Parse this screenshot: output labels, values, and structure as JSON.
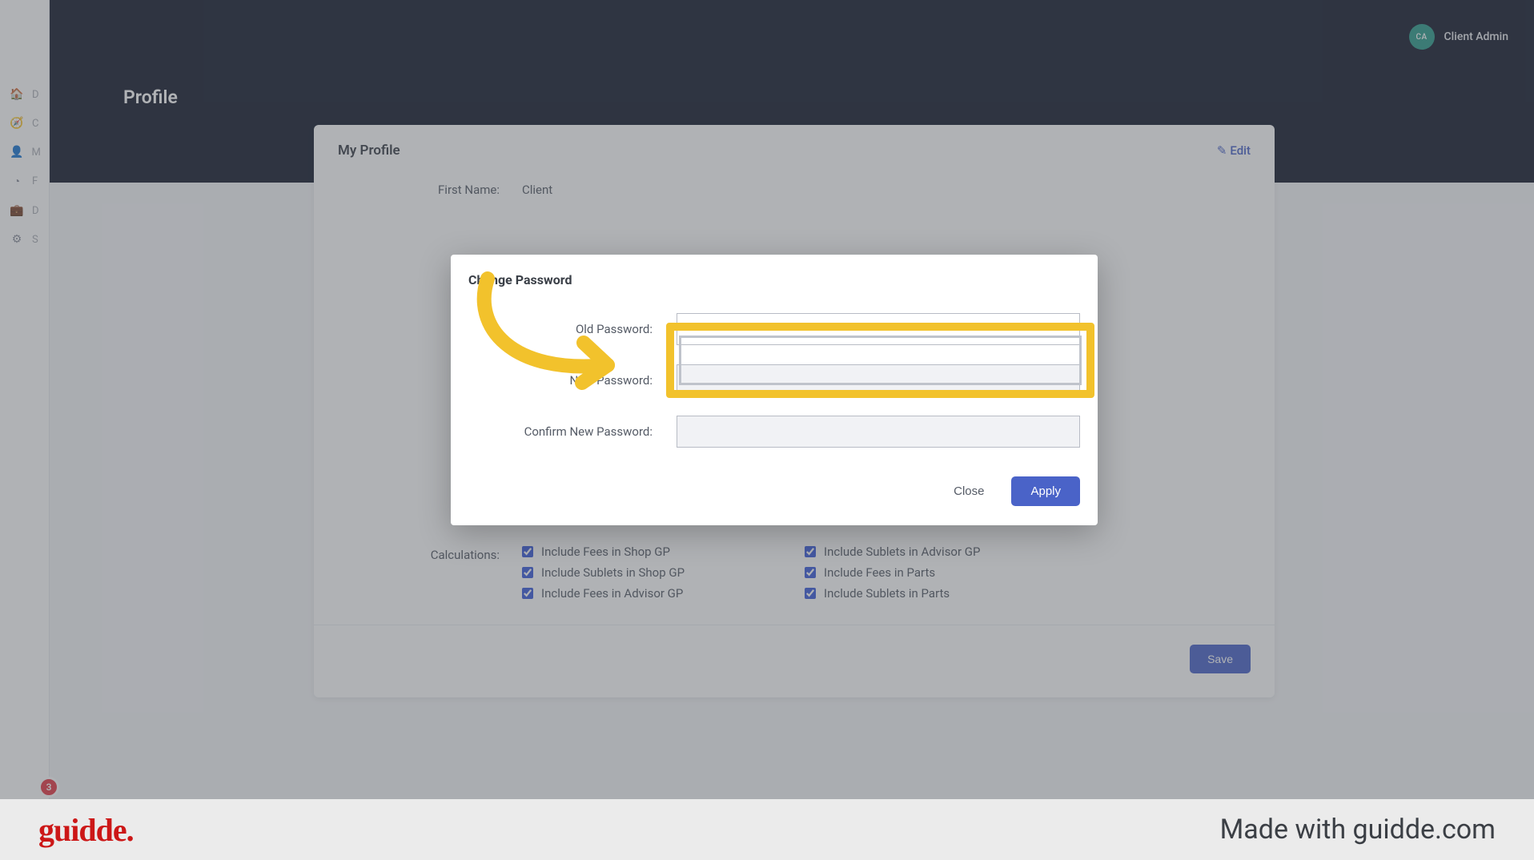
{
  "header": {
    "page_title": "Profile",
    "user_name": "Client Admin",
    "avatar_initials": "CA"
  },
  "sidebar": {
    "items": [
      {
        "icon": "🏠",
        "label": "D"
      },
      {
        "icon": "🧭",
        "label": "C"
      },
      {
        "icon": "👤",
        "label": "M"
      },
      {
        "icon": "◔",
        "label": "F"
      },
      {
        "icon": "💼",
        "label": "D"
      },
      {
        "icon": "⚙",
        "label": "S"
      }
    ],
    "badge": "3"
  },
  "profile_card": {
    "title": "My Profile",
    "edit_label": "Edit",
    "first_name_label": "First Name:",
    "first_name_value": "Client",
    "calculations_label": "Calculations:",
    "checks_left": [
      "Include Fees in Shop GP",
      "Include Sublets in Shop GP",
      "Include Fees in Advisor GP"
    ],
    "checks_right": [
      "Include Sublets in Advisor GP",
      "Include Fees in Parts",
      "Include Sublets in Parts"
    ],
    "save_label": "Save"
  },
  "modal": {
    "title": "Change Password",
    "old_label": "Old Password:",
    "new_label": "New Password:",
    "confirm_label": "Confirm New Password:",
    "close_label": "Close",
    "apply_label": "Apply"
  },
  "footer": {
    "logo_text": "guidde.",
    "made_with": "Made with guidde.com"
  },
  "colors": {
    "accent": "#4a63c8",
    "highlight": "#f2c22c",
    "header_bg": "#141b2d"
  }
}
